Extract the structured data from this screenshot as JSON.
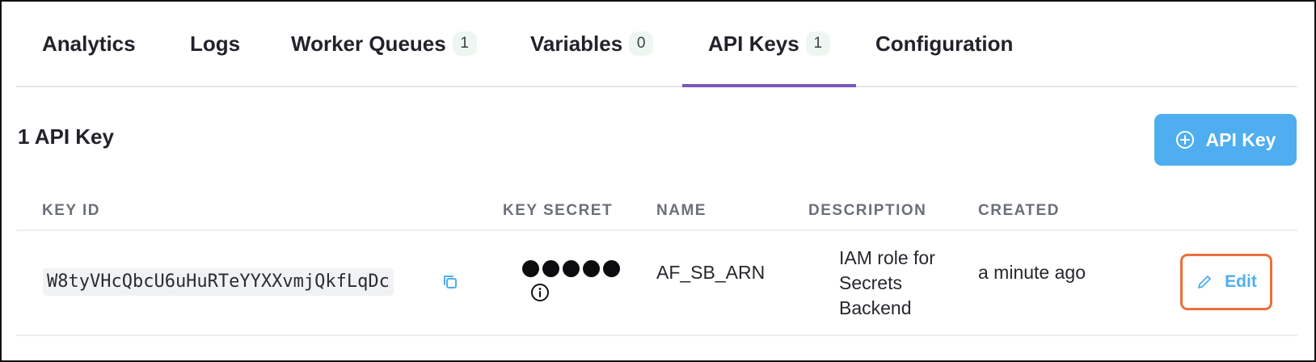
{
  "tabs": [
    {
      "label": "Analytics",
      "badge": null
    },
    {
      "label": "Logs",
      "badge": null
    },
    {
      "label": "Worker Queues",
      "badge": "1"
    },
    {
      "label": "Variables",
      "badge": "0"
    },
    {
      "label": "API Keys",
      "badge": "1",
      "active": true
    },
    {
      "label": "Configuration",
      "badge": null
    }
  ],
  "section": {
    "title": "1 API Key",
    "add_button_label": "API Key"
  },
  "table": {
    "columns": [
      "KEY ID",
      "KEY SECRET",
      "NAME",
      "DESCRIPTION",
      "CREATED"
    ],
    "rows": [
      {
        "key_id": "W8tyVHcQbcU6uHuRTeYYXXvmjQkfLqDc",
        "key_secret_dots": 5,
        "name": "AF_SB_ARN",
        "description": "IAM role for Secrets Backend",
        "created": "a minute ago",
        "edit_label": "Edit"
      }
    ]
  },
  "colors": {
    "accent_tab": "#7a56b8",
    "primary_button": "#4eaef0",
    "edit_highlight": "#e8703b",
    "badge_bg": "#eef6f1"
  },
  "icons": [
    "plus-circle-icon",
    "copy-icon",
    "info-icon",
    "pencil-icon"
  ]
}
